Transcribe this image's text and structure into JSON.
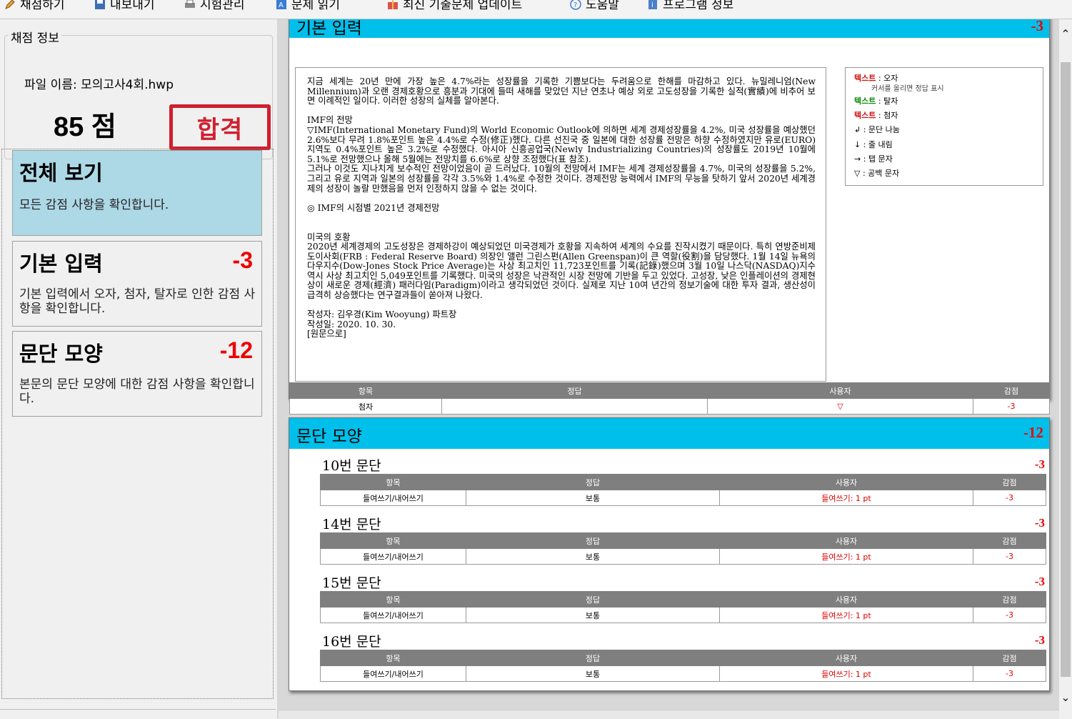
{
  "toolbar": {
    "items": [
      "채점하기",
      "내보내기",
      "시험관리",
      "문제 읽기",
      "최신 기출문제 업데이트",
      "도움말",
      "프로그램 정보"
    ]
  },
  "score_info": {
    "legend": "채점 정보",
    "file_label": "파일 이름: 모의고사4회.hwp",
    "score": "85 점",
    "stamp": "합격"
  },
  "categories": [
    {
      "title": "전체 보기",
      "score": "",
      "desc": "모든 감점 사항을 확인합니다."
    },
    {
      "title": "기본 입력",
      "score": "-3",
      "desc": "기본 입력에서 오자, 첨자, 탈자로 인한 감점 사항을 확인합니다."
    },
    {
      "title": "문단 모양",
      "score": "-12",
      "desc": "본문의 문단 모양에 대한 감점 사항을 확인합니다."
    }
  ],
  "basic_panel": {
    "title": "기본 입력",
    "score": "-3",
    "doc_text": "지금 세계는 20년 만에 가장 높은 4.7%라는 성장률을 기록한 기쁨보다는 두려움으로 한해를 마감하고 있다. 뉴밀레니엄(New Millennium)과 오랜 경제호황으로 흥분과 기대에 들떠 새해를 맞았던 지난 연초나 예상 외로 고도성장을 기록한 실적(實績)에 비추어 보면 이례적인 일이다. 이러한 성장의 실체를 알아본다.\n\nIMF의 전망\n▽IMF(International Monetary Fund)의 World Economic Outlook에 의하면 세계 경제성장률을 4.2%, 미국 성장률을 예상했던 2.6%보다 무려 1.8%포인트 높은 4.4%로 수정(修正)했다. 다른 선진국 중 일본에 대한 성장률 전망은 하향 수정하였지만 유로(EURO) 지역도 0.4%포인트 높은 3.2%로 수정했다. 아시아 신흥공업국(Newly Industrializing Countries)의 성장률도 2019년 10월에 5.1%로 전망했으나 올해 5월에는 전망치를 6.6%로 상향 조정했다(표 참조).\n그러나 이것도 지나치게 보수적인 전망이었음이 곧 드러났다. 10월의 전망에서 IMF는 세계 경제성장률을 4.7%, 미국의 성장률을 5.2%, 그리고 유로 지역과 일본의 성장률을 각각 3.5%와 1.4%로 수정한 것이다. 경제전망 능력에서 IMF의 무능을 탓하기 앞서 2020년 세계경제의 성장이 놀랄 만했음을 먼저 인정하지 않을 수 없는 것이다.\n\n◎ IMF의 시점별 2021년 경제전망\n\n\n미국의 호황\n2020년 세계경제의 고도성장은 경제하강이 예상되었던 미국경제가 호황을 지속하여 세계의 수요를 진작시켰기 때문이다. 특히 연방준비제도이사회(FRB : Federal Reserve Board) 의장인 앨런 그린스펀(Allen Greenspan)이 큰 역할(役割)을 담당했다. 1월 14일 뉴욕의 다우지수(Dow-Jones Stock Price Average)는 사상 최고치인 11,723포인트를 기록(記錄)했으며 3월 10일 나스닥(NASDAQ)지수 역시 사상 최고치인 5,049포인트를 기록했다. 미국의 성장은 낙관적인 시장 전망에 기반을 두고 있었다. 고성장, 낮은 인플레이션의 경제현상이 새로운 경제(經濟) 패러다임(Paradigm)이라고 생각되었던 것이다. 실제로 지난 10여 년간의 정보기술에 대한 투자 결과, 생산성이 급격히 상승했다는 연구결과들이 쏟아져 나왔다.\n\n작성자: 김우경(Kim Wooyung) 파트장\n작성일: 2020. 10. 30.\n[원문으로]",
    "legend": [
      {
        "key": "텍스트",
        "sep": " : ",
        "label": "오자",
        "color": "#d01010",
        "sub": "커서를 올리면 정답 표시"
      },
      {
        "key": "텍스트",
        "sep": " : ",
        "label": "탈자",
        "color": "#0a8a0a",
        "sub": ""
      },
      {
        "key": "텍스트",
        "sep": " : ",
        "label": "첨자",
        "color": "#d01010",
        "sub": ""
      },
      {
        "key": "↲",
        "sep": " : ",
        "label": "문단 나눔",
        "color": "#000000",
        "sub": ""
      },
      {
        "key": "↓",
        "sep": " : ",
        "label": "줄 내림",
        "color": "#000000",
        "sub": ""
      },
      {
        "key": "→",
        "sep": " : ",
        "label": "탭 문자",
        "color": "#000000",
        "sub": ""
      },
      {
        "key": "▽",
        "sep": " : ",
        "label": "공백 문자",
        "color": "#000000",
        "sub": ""
      }
    ],
    "table": {
      "headers": [
        "항목",
        "정답",
        "사용자",
        "감점"
      ],
      "rows": [
        [
          "첨자",
          "",
          "▽",
          "-3"
        ]
      ]
    }
  },
  "para_panel": {
    "title": "문단 모양",
    "score": "-12",
    "groups": [
      {
        "title": "10번 문단",
        "score": "-3",
        "headers": [
          "항목",
          "정답",
          "사용자",
          "감점"
        ],
        "row": [
          "들여쓰기/내어쓰기",
          "보통",
          "들여쓰기: 1 pt",
          "-3"
        ]
      },
      {
        "title": "14번 문단",
        "score": "-3",
        "headers": [
          "항목",
          "정답",
          "사용자",
          "감점"
        ],
        "row": [
          "들여쓰기/내어쓰기",
          "보통",
          "들여쓰기: 1 pt",
          "-3"
        ]
      },
      {
        "title": "15번 문단",
        "score": "-3",
        "headers": [
          "항목",
          "정답",
          "사용자",
          "감점"
        ],
        "row": [
          "들여쓰기/내어쓰기",
          "보통",
          "들여쓰기: 1 pt",
          "-3"
        ]
      },
      {
        "title": "16번 문단",
        "score": "-3",
        "headers": [
          "항목",
          "정답",
          "사용자",
          "감점"
        ],
        "row": [
          "들여쓰기/내어쓰기",
          "보통",
          "들여쓰기: 1 pt",
          "-3"
        ]
      }
    ]
  },
  "colors": {
    "accent": "#00bfea",
    "selected": "#add8e6",
    "deduct": "#e00000",
    "stamp": "#cf1f2f"
  }
}
